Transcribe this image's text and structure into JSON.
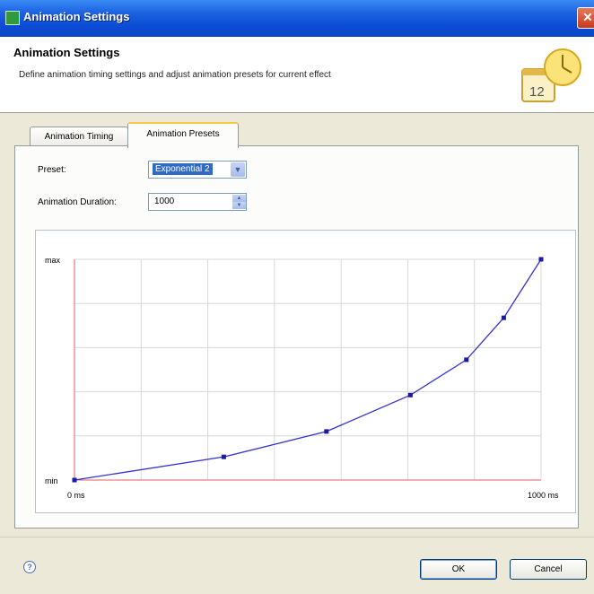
{
  "window": {
    "title": "Animation Settings",
    "close_glyph": "✕",
    "accent": "#0b4ed6"
  },
  "header": {
    "title": "Animation Settings",
    "description": "Define animation timing settings and adjust animation presets for current effect",
    "icon": "clock-calendar-icon",
    "calendar_number": "12"
  },
  "tabs": [
    {
      "label": "Animation Timing",
      "active": false
    },
    {
      "label": "Animation Presets",
      "active": true
    }
  ],
  "form": {
    "preset_label": "Preset:",
    "preset_value": "Exponential 2",
    "duration_label": "Animation Duration:",
    "duration_value": "1000"
  },
  "chart_data": {
    "type": "line",
    "ylabel_top": "max",
    "ylabel_bottom": "min",
    "x_start_label": "0 ms",
    "x_end_label": "1000 ms",
    "xlim": [
      0,
      1000
    ],
    "ylim": [
      0,
      1
    ],
    "grid": true,
    "line_color": "#3333cc",
    "axis_color": "#e06060",
    "series": [
      {
        "points": [
          [
            0,
            0.0
          ],
          [
            320,
            0.105
          ],
          [
            540,
            0.22
          ],
          [
            720,
            0.385
          ],
          [
            840,
            0.545
          ],
          [
            920,
            0.735
          ],
          [
            1000,
            1.0
          ]
        ]
      }
    ]
  },
  "footer": {
    "help_glyph": "?",
    "ok_label": "OK",
    "cancel_label": "Cancel"
  }
}
